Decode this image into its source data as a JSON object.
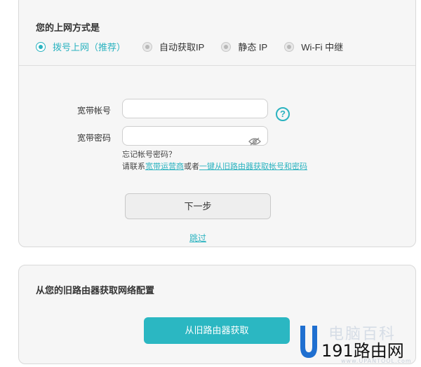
{
  "connection": {
    "title": "您的上网方式是",
    "options": [
      {
        "label": "拨号上网（推荐）",
        "selected": true
      },
      {
        "label": "自动获取IP",
        "selected": false
      },
      {
        "label": "静态 IP",
        "selected": false
      },
      {
        "label": "Wi-Fi 中继",
        "selected": false
      }
    ]
  },
  "form": {
    "account_label": "宽带帐号",
    "account_value": "",
    "password_label": "宽带密码",
    "password_value": "",
    "help_icon": "question-circle-icon",
    "eye_icon": "eye-hidden-icon",
    "forgot_text": "忘记帐号密码？",
    "contact_prefix": "请联系",
    "isp_link": "宽带运营商",
    "contact_or": "或者",
    "oneclick_link": "一键从旧路由器获取帐号和密码",
    "next_button": "下一步",
    "skip_link": "跳过"
  },
  "old_router": {
    "title": "从您的旧路由器获取网络配置",
    "fetch_button": "从旧路由器获取"
  },
  "watermark": {
    "top_text": "电脑百科",
    "main_text": "191路由网",
    "small_text": "www.UPANTOOL.com"
  },
  "colors": {
    "accent": "#2bb3c0",
    "card_bg": "#f6f6f6",
    "border": "#d9d9d9"
  }
}
